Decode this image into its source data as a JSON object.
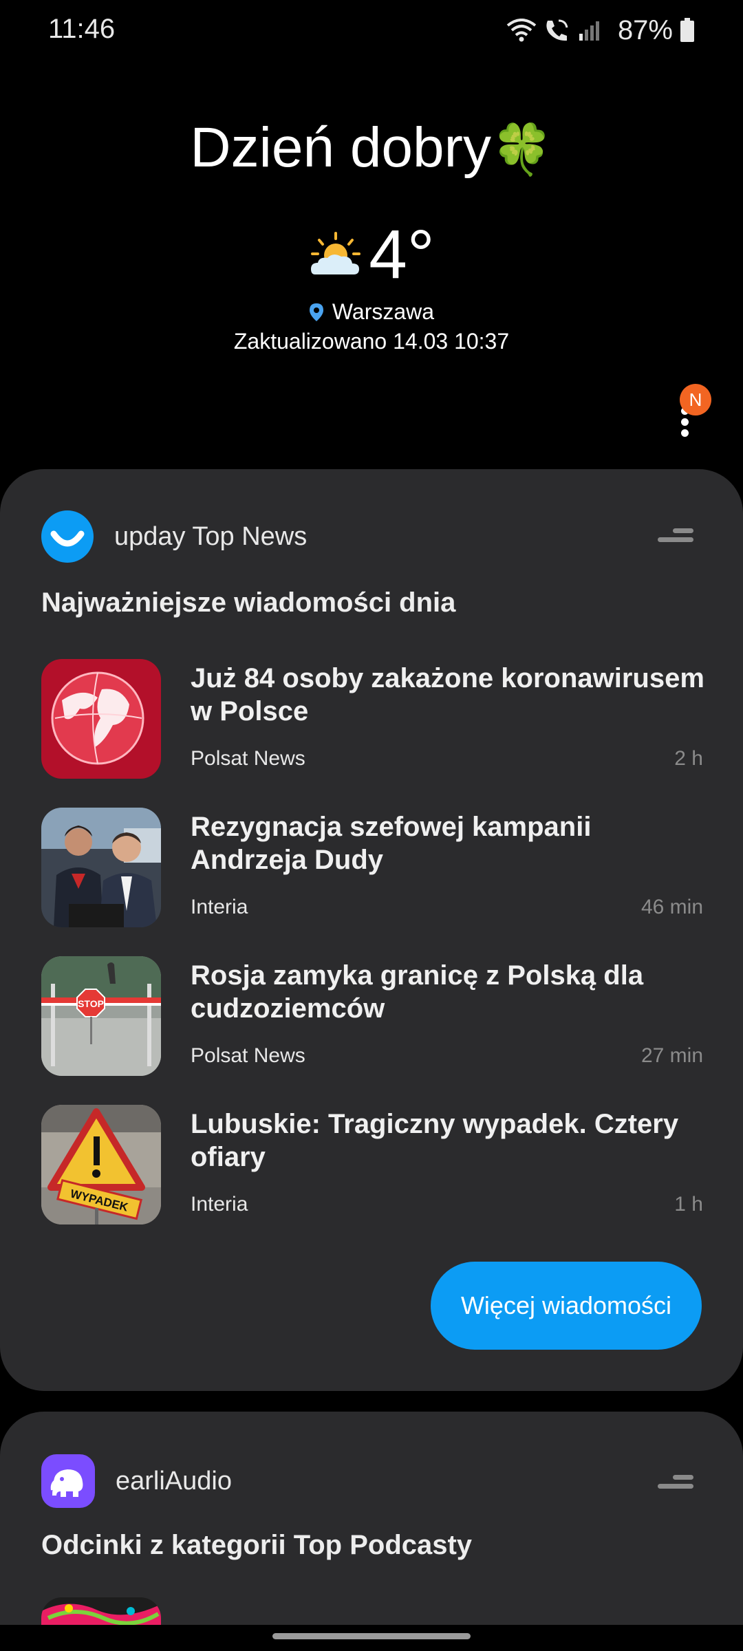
{
  "status_bar": {
    "time": "11:46",
    "battery_percent": "87%"
  },
  "briefing": {
    "greeting": "Dzień dobry",
    "greeting_emoji": "🍀",
    "temperature": "4°",
    "location": "Warszawa",
    "updated": "Zaktualizowano 14.03 10:37",
    "notification_badge": "N"
  },
  "upday_card": {
    "app_name": "upday Top News",
    "section_title": "Najważniejsze wiadomości dnia",
    "news": [
      {
        "title": "Już 84 osoby zakażone koronawirusem w Polsce",
        "source": "Polsat News",
        "time": "2 h"
      },
      {
        "title": "Rezygnacja szefowej kampanii Andrzeja Dudy",
        "source": "Interia",
        "time": "46 min"
      },
      {
        "title": "Rosja zamyka granicę z Polską dla cudzoziemców",
        "source": "Polsat News",
        "time": "27 min"
      },
      {
        "title": "Lubuskie: Tragiczny wypadek. Cztery ofiary",
        "source": "Interia",
        "time": "1 h"
      }
    ],
    "more_button": "Więcej wiadomości",
    "stop_sign_text": "STOP",
    "wypadek_sign_text": "WYPADEK"
  },
  "earli_card": {
    "app_name": "earliAudio",
    "section_title": "Odcinki z kategorii Top Podcasty"
  },
  "colors": {
    "accent": "#0c9cf4",
    "badge": "#f26522",
    "card": "#2b2b2d",
    "earli": "#7b4dff"
  }
}
